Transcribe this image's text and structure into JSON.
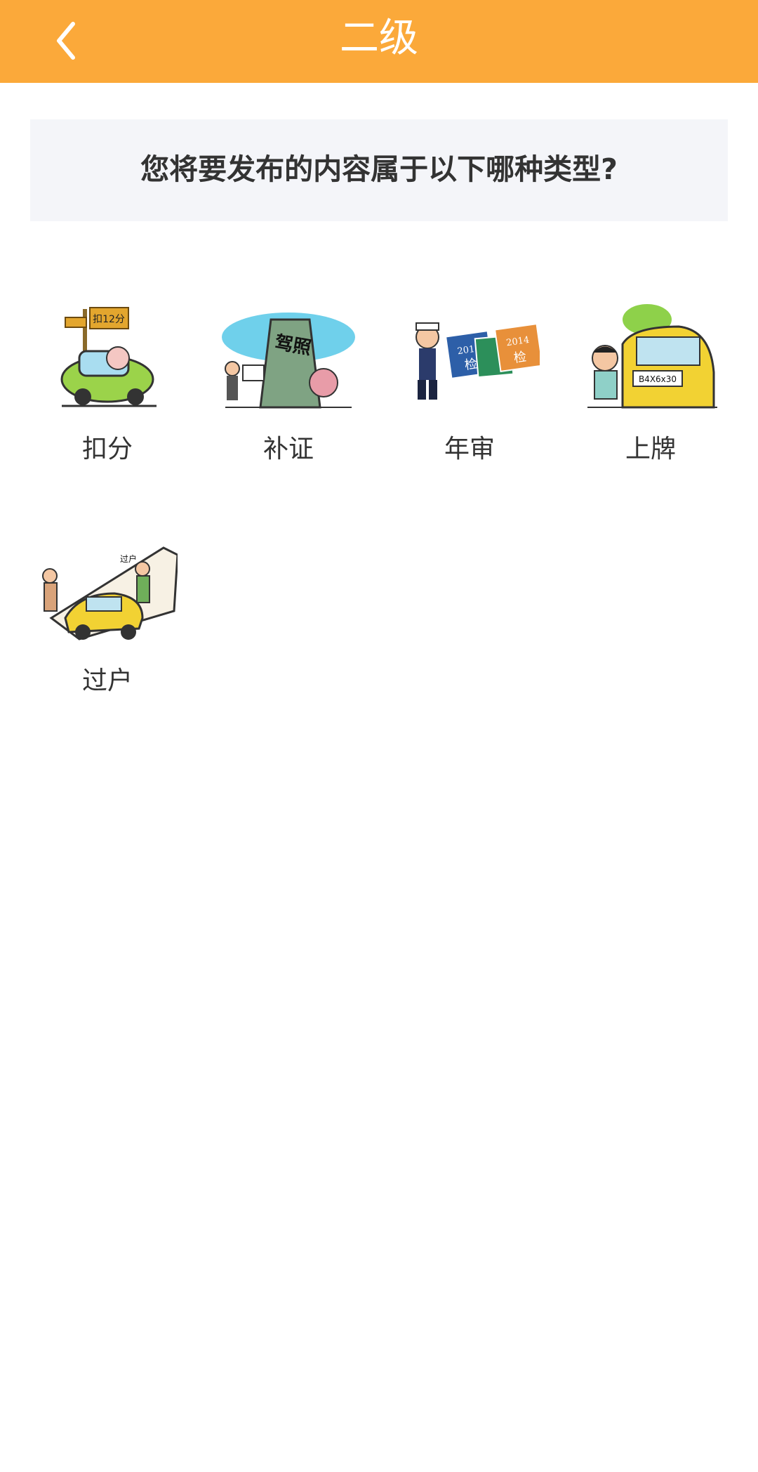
{
  "header": {
    "title": "二级",
    "back_icon": "chevron-left-icon",
    "background_color": "#FBA93A"
  },
  "question": {
    "text": "您将要发布的内容属于以下哪种类型?"
  },
  "categories": [
    {
      "label": "扣分",
      "image_icon": "penalty-points-illustration",
      "sign_text": "扣12分"
    },
    {
      "label": "补证",
      "image_icon": "license-reissue-illustration",
      "sign_text": "驾照"
    },
    {
      "label": "年审",
      "image_icon": "annual-inspection-illustration",
      "sticker_year_1": "2013",
      "sticker_year_2": "2014",
      "sticker_text": "检"
    },
    {
      "label": "上牌",
      "image_icon": "license-plate-illustration",
      "plate_text": "B4X6x30"
    },
    {
      "label": "过户",
      "image_icon": "ownership-transfer-illustration",
      "doc_text": "过户"
    }
  ]
}
